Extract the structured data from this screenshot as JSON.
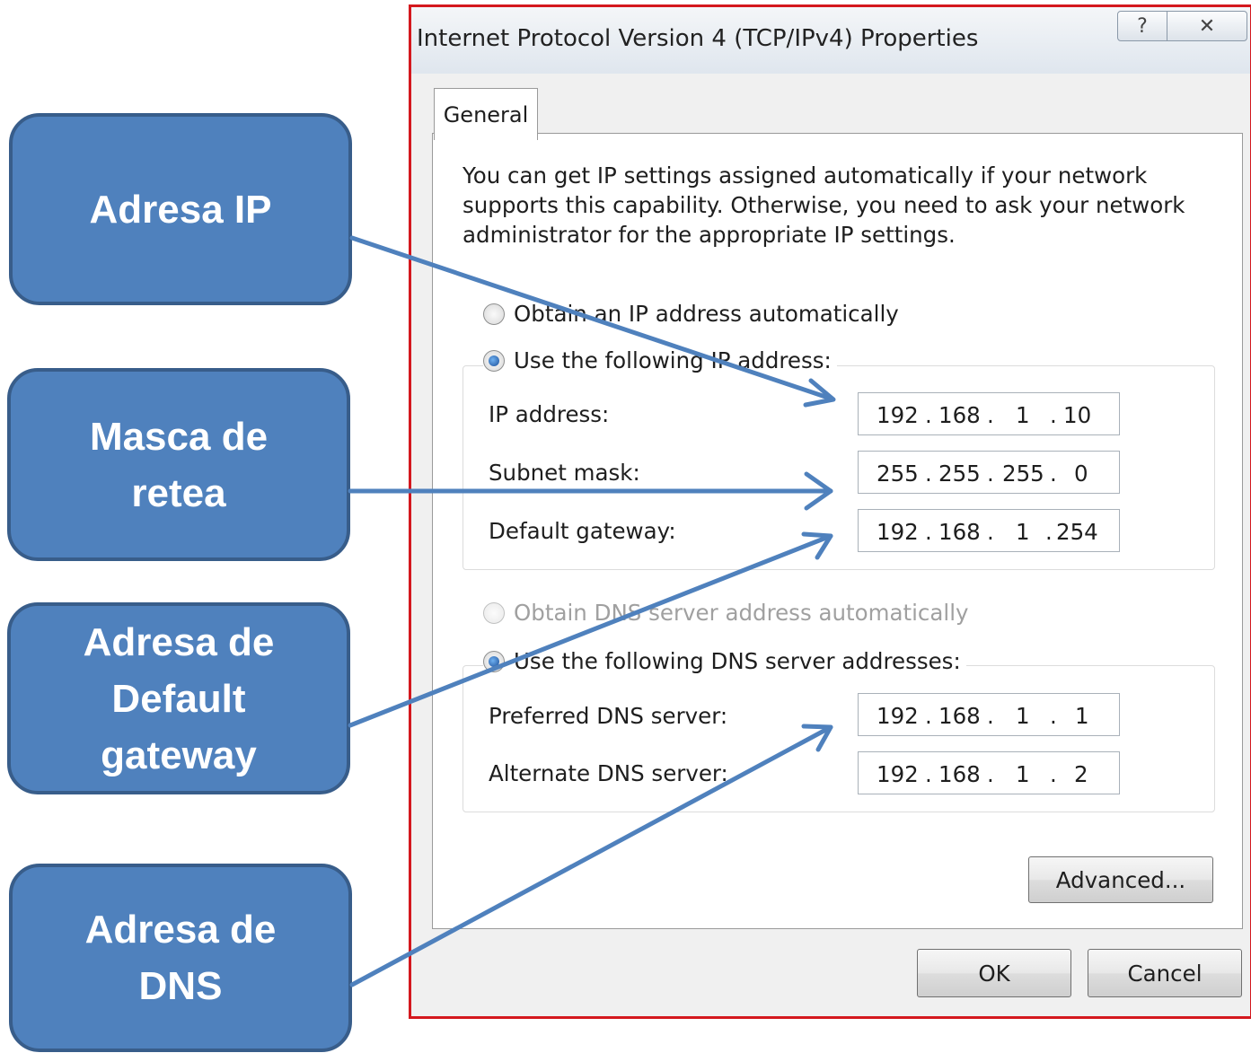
{
  "callouts": {
    "ip": "Adresa IP",
    "mask": "Masca de\nretea",
    "gateway": "Adresa de\nDefault\ngateway",
    "dns": "Adresa de\nDNS"
  },
  "dialog": {
    "title": "Internet Protocol Version 4 (TCP/IPv4) Properties",
    "help_glyph": "?",
    "close_glyph": "✕",
    "tab_general": "General",
    "intro": "You can get IP settings assigned automatically if your network supports this capability. Otherwise, you need to ask your network administrator for the appropriate IP settings.",
    "ip_auto_label": "Obtain an IP address automatically",
    "ip_manual_label": "Use the following IP address:",
    "ip_address_label": "IP address:",
    "subnet_mask_label": "Subnet mask:",
    "default_gateway_label": "Default gateway:",
    "ip_address": [
      "192",
      "168",
      "1",
      "10"
    ],
    "subnet_mask": [
      "255",
      "255",
      "255",
      "0"
    ],
    "default_gateway": [
      "192",
      "168",
      "1",
      "254"
    ],
    "dns_auto_label": "Obtain DNS server address automatically",
    "dns_manual_label": "Use the following DNS server addresses:",
    "preferred_dns_label": "Preferred DNS server:",
    "alternate_dns_label": "Alternate DNS server:",
    "preferred_dns": [
      "192",
      "168",
      "1",
      "1"
    ],
    "alternate_dns": [
      "192",
      "168",
      "1",
      "2"
    ],
    "advanced_button": "Advanced...",
    "ok_button": "OK",
    "cancel_button": "Cancel",
    "octet_separator": "."
  },
  "colors": {
    "callout_fill": "#4f81bd",
    "callout_border": "#385d8a",
    "arrow": "#4f81bd",
    "dialog_frame": "#d4181e"
  }
}
